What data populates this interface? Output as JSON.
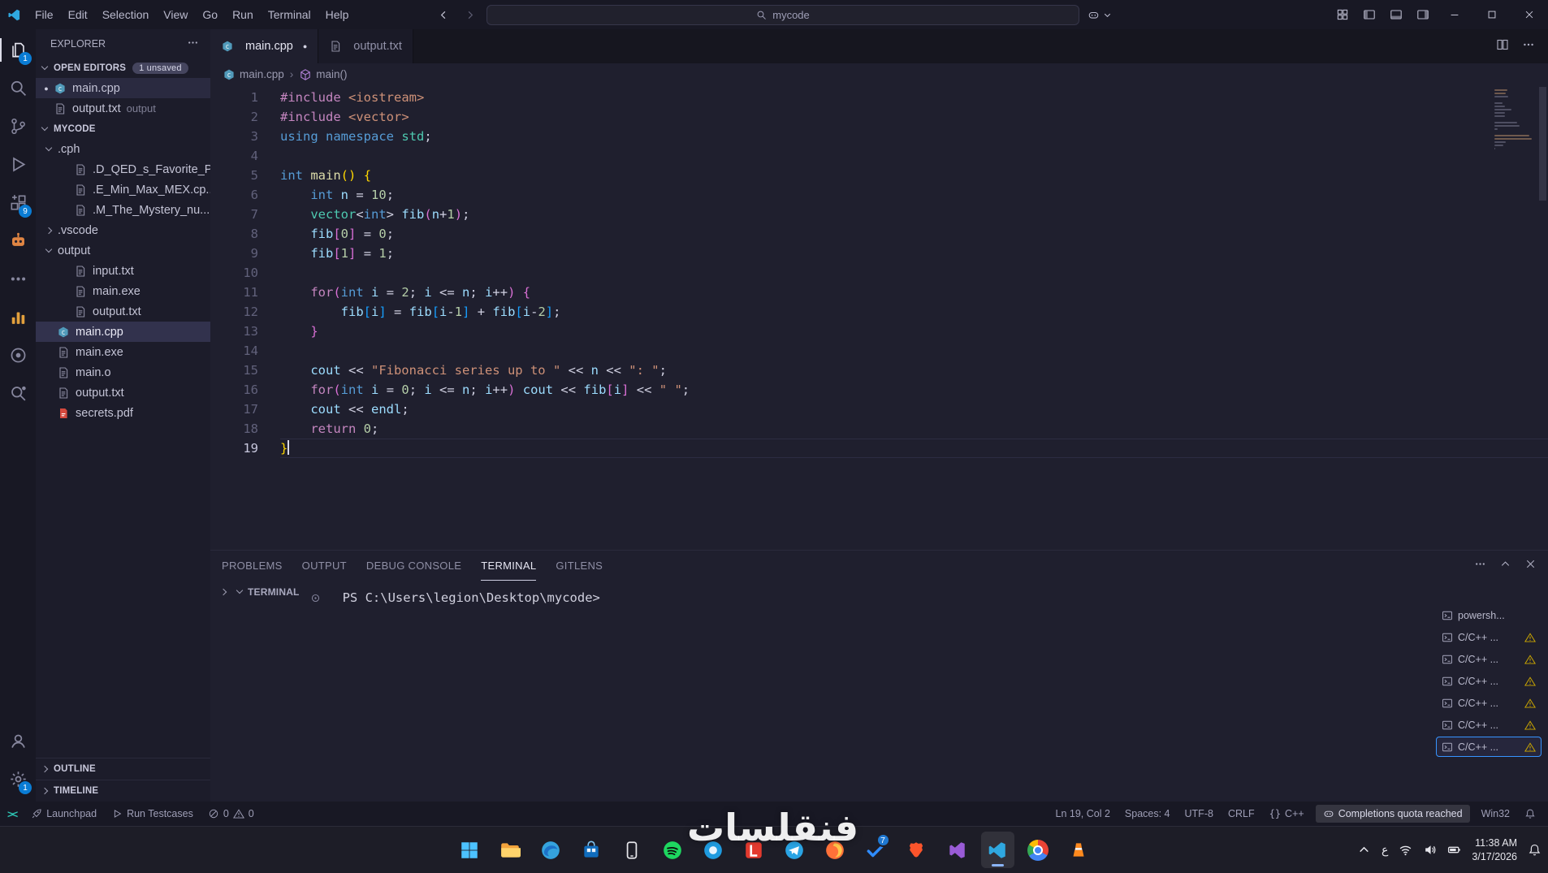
{
  "titlebar": {
    "menus": [
      "File",
      "Edit",
      "Selection",
      "View",
      "Go",
      "Run",
      "Terminal",
      "Help"
    ],
    "search": {
      "value": "mycode"
    }
  },
  "activity_bar": {
    "top": [
      {
        "name": "explorer",
        "icon": "files",
        "active": true,
        "badge": "1"
      },
      {
        "name": "search",
        "icon": "search"
      },
      {
        "name": "source-control",
        "icon": "git"
      },
      {
        "name": "run-and-debug",
        "icon": "debug"
      },
      {
        "name": "extensions",
        "icon": "ext",
        "badge": "9"
      },
      {
        "name": "ai-assistant",
        "icon": "robot"
      },
      {
        "name": "more-tools",
        "icon": "dots"
      },
      {
        "name": "analytics",
        "icon": "chart"
      },
      {
        "name": "gitlens",
        "icon": "gitlens"
      },
      {
        "name": "remote-explorer",
        "icon": "rsearch"
      }
    ],
    "bottom": [
      {
        "name": "accounts",
        "icon": "account"
      },
      {
        "name": "settings",
        "icon": "gear",
        "badge": "1"
      }
    ]
  },
  "sidebar": {
    "title": "EXPLORER",
    "open_editors": {
      "label": "OPEN EDITORS",
      "badge": "1 unsaved",
      "items": [
        {
          "label": "main.cpp",
          "icon": "cpp",
          "modified": true,
          "active": true
        },
        {
          "label": "output.txt",
          "icon": "txt",
          "description": "output"
        }
      ]
    },
    "workspace": {
      "label": "MYCODE",
      "tree": [
        {
          "label": ".cph",
          "type": "folder",
          "expanded": true,
          "indent": 0
        },
        {
          "label": ".D_QED_s_Favorite_P...",
          "icon": "txt",
          "indent": 1
        },
        {
          "label": ".E_Min_Max_MEX.cp...",
          "icon": "txt",
          "indent": 1
        },
        {
          "label": ".M_The_Mystery_nu...",
          "icon": "txt",
          "indent": 1
        },
        {
          "label": ".vscode",
          "type": "folder",
          "expanded": false,
          "indent": 0
        },
        {
          "label": "output",
          "type": "folder",
          "expanded": true,
          "indent": 0
        },
        {
          "label": "input.txt",
          "icon": "txt",
          "indent": 1
        },
        {
          "label": "main.exe",
          "icon": "txt",
          "indent": 1
        },
        {
          "label": "output.txt",
          "icon": "txt",
          "indent": 1
        },
        {
          "label": "main.cpp",
          "icon": "cpp",
          "indent": 0,
          "selected": true
        },
        {
          "label": "main.exe",
          "icon": "txt",
          "indent": 0
        },
        {
          "label": "main.o",
          "icon": "txt",
          "indent": 0
        },
        {
          "label": "output.txt",
          "icon": "txt",
          "indent": 0
        },
        {
          "label": "secrets.pdf",
          "icon": "pdf",
          "indent": 0
        }
      ]
    },
    "sections": [
      "OUTLINE",
      "TIMELINE"
    ]
  },
  "editor": {
    "tabs": [
      {
        "label": "main.cpp",
        "icon": "cpp",
        "active": true,
        "modified": true
      },
      {
        "label": "output.txt",
        "icon": "txt"
      }
    ],
    "breadcrumb": [
      {
        "label": "main.cpp",
        "icon": "file-cpp"
      },
      {
        "label": "main()",
        "icon": "symbol-method"
      }
    ],
    "active_line": 19,
    "code": {
      "language": "cpp",
      "lines": [
        [
          [
            "pk",
            "#include"
          ],
          [
            "df",
            " "
          ],
          [
            "or",
            "<iostream>"
          ]
        ],
        [
          [
            "pk",
            "#include"
          ],
          [
            "df",
            " "
          ],
          [
            "or",
            "<vector>"
          ]
        ],
        [
          [
            "bl",
            "using"
          ],
          [
            "df",
            " "
          ],
          [
            "bl",
            "namespace"
          ],
          [
            "df",
            " "
          ],
          [
            "tl",
            "std"
          ],
          [
            "df",
            ";"
          ]
        ],
        [],
        [
          [
            "bl",
            "int"
          ],
          [
            "df",
            " "
          ],
          [
            "fn",
            "main"
          ],
          [
            "b1",
            "()"
          ],
          [
            "df",
            " "
          ],
          [
            "b1",
            "{"
          ]
        ],
        [
          [
            "df",
            "    "
          ],
          [
            "bl",
            "int"
          ],
          [
            "df",
            " "
          ],
          [
            "vr",
            "n"
          ],
          [
            "df",
            " = "
          ],
          [
            "nm",
            "10"
          ],
          [
            "df",
            ";"
          ]
        ],
        [
          [
            "df",
            "    "
          ],
          [
            "tl",
            "vector"
          ],
          [
            "df",
            "<"
          ],
          [
            "bl",
            "int"
          ],
          [
            "df",
            "> "
          ],
          [
            "vr",
            "fib"
          ],
          [
            "b2",
            "("
          ],
          [
            "vr",
            "n"
          ],
          [
            "df",
            "+"
          ],
          [
            "nm",
            "1"
          ],
          [
            "b2",
            ")"
          ],
          [
            "df",
            ";"
          ]
        ],
        [
          [
            "df",
            "    "
          ],
          [
            "vr",
            "fib"
          ],
          [
            "b2",
            "["
          ],
          [
            "nm",
            "0"
          ],
          [
            "b2",
            "]"
          ],
          [
            "df",
            " = "
          ],
          [
            "nm",
            "0"
          ],
          [
            "df",
            ";"
          ]
        ],
        [
          [
            "df",
            "    "
          ],
          [
            "vr",
            "fib"
          ],
          [
            "b2",
            "["
          ],
          [
            "nm",
            "1"
          ],
          [
            "b2",
            "]"
          ],
          [
            "df",
            " = "
          ],
          [
            "nm",
            "1"
          ],
          [
            "df",
            ";"
          ]
        ],
        [],
        [
          [
            "df",
            "    "
          ],
          [
            "pk",
            "for"
          ],
          [
            "b2",
            "("
          ],
          [
            "bl",
            "int"
          ],
          [
            "df",
            " "
          ],
          [
            "vr",
            "i"
          ],
          [
            "df",
            " = "
          ],
          [
            "nm",
            "2"
          ],
          [
            "df",
            "; "
          ],
          [
            "vr",
            "i"
          ],
          [
            "df",
            " <= "
          ],
          [
            "vr",
            "n"
          ],
          [
            "df",
            "; "
          ],
          [
            "vr",
            "i"
          ],
          [
            "df",
            "++"
          ],
          [
            "b2",
            ")"
          ],
          [
            "df",
            " "
          ],
          [
            "b2",
            "{"
          ]
        ],
        [
          [
            "df",
            "        "
          ],
          [
            "vr",
            "fib"
          ],
          [
            "b3",
            "["
          ],
          [
            "vr",
            "i"
          ],
          [
            "b3",
            "]"
          ],
          [
            "df",
            " = "
          ],
          [
            "vr",
            "fib"
          ],
          [
            "b3",
            "["
          ],
          [
            "vr",
            "i"
          ],
          [
            "df",
            "-"
          ],
          [
            "nm",
            "1"
          ],
          [
            "b3",
            "]"
          ],
          [
            "df",
            " + "
          ],
          [
            "vr",
            "fib"
          ],
          [
            "b3",
            "["
          ],
          [
            "vr",
            "i"
          ],
          [
            "df",
            "-"
          ],
          [
            "nm",
            "2"
          ],
          [
            "b3",
            "]"
          ],
          [
            "df",
            ";"
          ]
        ],
        [
          [
            "df",
            "    "
          ],
          [
            "b2",
            "}"
          ]
        ],
        [],
        [
          [
            "df",
            "    "
          ],
          [
            "vr",
            "cout"
          ],
          [
            "df",
            " << "
          ],
          [
            "or",
            "\"Fibonacci series up to \""
          ],
          [
            "df",
            " << "
          ],
          [
            "vr",
            "n"
          ],
          [
            "df",
            " << "
          ],
          [
            "or",
            "\": \""
          ],
          [
            "df",
            ";"
          ]
        ],
        [
          [
            "df",
            "    "
          ],
          [
            "pk",
            "for"
          ],
          [
            "b2",
            "("
          ],
          [
            "bl",
            "int"
          ],
          [
            "df",
            " "
          ],
          [
            "vr",
            "i"
          ],
          [
            "df",
            " = "
          ],
          [
            "nm",
            "0"
          ],
          [
            "df",
            "; "
          ],
          [
            "vr",
            "i"
          ],
          [
            "df",
            " <= "
          ],
          [
            "vr",
            "n"
          ],
          [
            "df",
            "; "
          ],
          [
            "vr",
            "i"
          ],
          [
            "df",
            "++"
          ],
          [
            "b2",
            ")"
          ],
          [
            "df",
            " "
          ],
          [
            "vr",
            "cout"
          ],
          [
            "df",
            " << "
          ],
          [
            "vr",
            "fib"
          ],
          [
            "b2",
            "["
          ],
          [
            "vr",
            "i"
          ],
          [
            "b2",
            "]"
          ],
          [
            "df",
            " << "
          ],
          [
            "or",
            "\" \""
          ],
          [
            "df",
            ";"
          ]
        ],
        [
          [
            "df",
            "    "
          ],
          [
            "vr",
            "cout"
          ],
          [
            "df",
            " << "
          ],
          [
            "vr",
            "endl"
          ],
          [
            "df",
            ";"
          ]
        ],
        [
          [
            "df",
            "    "
          ],
          [
            "pk",
            "return"
          ],
          [
            "df",
            " "
          ],
          [
            "nm",
            "0"
          ],
          [
            "df",
            ";"
          ]
        ],
        [
          [
            "b1",
            "}"
          ]
        ]
      ]
    }
  },
  "panel": {
    "tabs": [
      "PROBLEMS",
      "OUTPUT",
      "DEBUG CONSOLE",
      "TERMINAL",
      "GITLENS"
    ],
    "active_tab": "TERMINAL",
    "terminal": {
      "header": "TERMINAL",
      "prompt": "PS C:\\Users\\legion\\Desktop\\mycode>",
      "sessions": [
        {
          "label": "powersh...",
          "icon": "terminal"
        },
        {
          "label": "C/C++ ...",
          "icon": "terminal",
          "warning": true
        },
        {
          "label": "C/C++ ...",
          "icon": "terminal",
          "warning": true
        },
        {
          "label": "C/C++ ...",
          "icon": "terminal",
          "warning": true
        },
        {
          "label": "C/C++ ...",
          "icon": "terminal",
          "warning": true
        },
        {
          "label": "C/C++ ...",
          "icon": "terminal",
          "warning": true
        },
        {
          "label": "C/C++ ...",
          "icon": "terminal",
          "warning": true,
          "selected": true
        }
      ]
    }
  },
  "status_bar": {
    "left": [
      {
        "name": "remote-indicator",
        "icon": "remote"
      },
      {
        "name": "launchpad",
        "icon": "rocket",
        "label": "Launchpad"
      },
      {
        "name": "run-testcases",
        "icon": "play",
        "label": "Run Testcases"
      },
      {
        "name": "problems",
        "parts": [
          {
            "icon": "circle-slash"
          },
          {
            "text": "0"
          },
          {
            "icon": "warning"
          },
          {
            "text": "0"
          }
        ]
      }
    ],
    "right": [
      {
        "name": "cursor-position",
        "label": "Ln 19, Col 2"
      },
      {
        "name": "indentation",
        "label": "Spaces: 4"
      },
      {
        "name": "encoding",
        "label": "UTF-8"
      },
      {
        "name": "eol-sequence",
        "label": "CRLF"
      },
      {
        "name": "language-mode",
        "icon": "braces",
        "label": "C++"
      },
      {
        "name": "copilot-quota",
        "icon": "copilot",
        "label": "Completions quota reached",
        "highlight": true
      },
      {
        "name": "platform",
        "label": "Win32"
      },
      {
        "name": "notifications-bell",
        "icon": "bell"
      }
    ]
  },
  "taskbar": {
    "apps": [
      {
        "name": "start"
      },
      {
        "name": "file-explorer"
      },
      {
        "name": "edge"
      },
      {
        "name": "ms-store"
      },
      {
        "name": "phone-link"
      },
      {
        "name": "spotify"
      },
      {
        "name": "app-blue"
      },
      {
        "name": "app-l"
      },
      {
        "name": "telegram"
      },
      {
        "name": "firefox"
      },
      {
        "name": "ms-todo",
        "badge": "7"
      },
      {
        "name": "brave"
      },
      {
        "name": "visual-studio"
      },
      {
        "name": "vscode",
        "active": true
      },
      {
        "name": "chrome"
      },
      {
        "name": "vlc"
      }
    ],
    "tray": {
      "language": "ع",
      "time": "11:38 AM",
      "date": "3/17/2026"
    }
  },
  "watermark": "فنقلسات",
  "colors": {
    "accent": "#0a7cd4",
    "selection": "#3794ff",
    "warning": "#cca700",
    "remote": "#2dc5b4"
  }
}
